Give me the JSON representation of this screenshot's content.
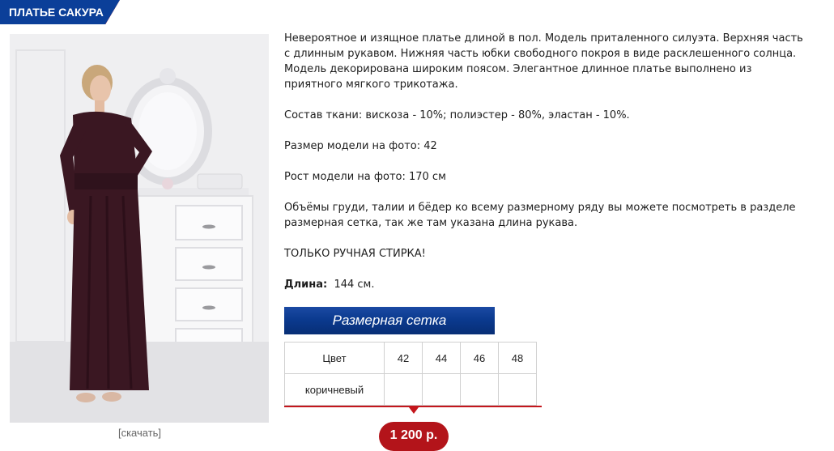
{
  "header": {
    "title": "ПЛАТЬЕ САКУРА"
  },
  "photo": {
    "download_label": "[скачать]"
  },
  "description": {
    "intro": "Невероятное и изящное платье длиной в пол. Модель приталенного силуэта. Верхняя часть с длинным рукавом. Нижняя часть юбки свободного покроя в виде расклешенного солнца. Модель декорирована широким поясом.  Элегантное длинное платье выполнено из приятного мягкого трикотажа.",
    "fabric": "Состав ткани: вискоза - 10%; полиэстер - 80%, эластан - 10%.",
    "model_size": "Размер модели на фото: 42",
    "model_height": "Рост модели на фото: 170 см",
    "volumes": "Объёмы груди, талии и бёдер ко всему размерному ряду вы можете посмотреть в разделе размерная сетка, так же там указана длина рукава.",
    "wash": "ТОЛЬКО РУЧНАЯ СТИРКА!",
    "length_label": "Длина:",
    "length_value": "144 см."
  },
  "size_grid": {
    "button_label": "Размерная сетка",
    "color_header": "Цвет",
    "sizes": [
      "42",
      "44",
      "46",
      "48"
    ],
    "rows": [
      {
        "color": "коричневый"
      }
    ]
  },
  "price": {
    "label": "1 200 р."
  },
  "colors": {
    "brand_blue": "#0b3f99",
    "accent_red": "#c4161c",
    "dress": "#3a1722"
  }
}
